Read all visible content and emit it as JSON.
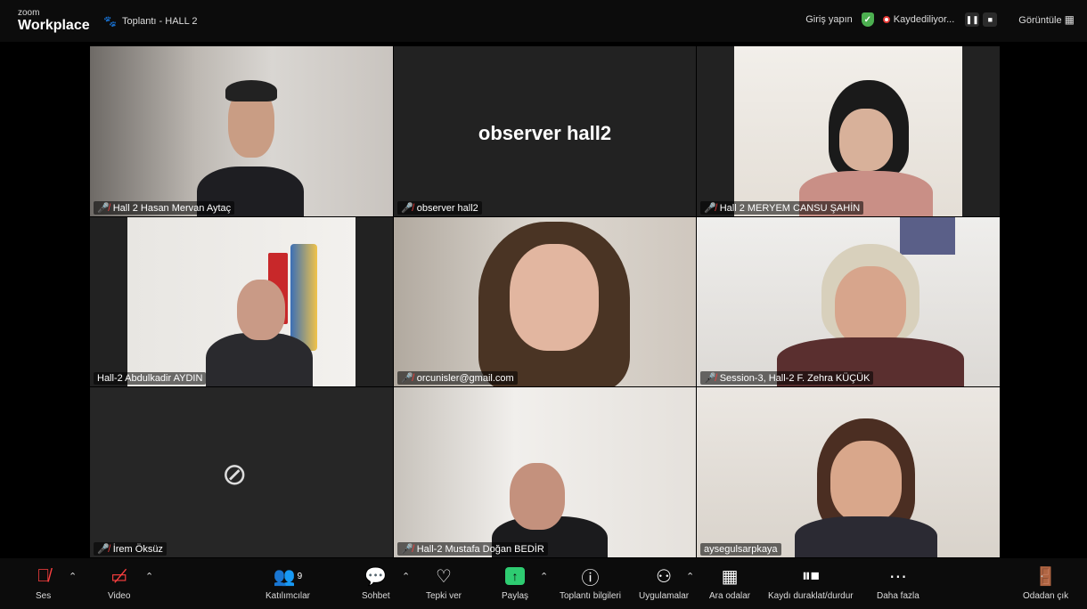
{
  "app": {
    "brand_small": "zoom",
    "brand_large": "Workplace"
  },
  "meeting": {
    "title": "Toplantı - HALL 2"
  },
  "topbar": {
    "signin": "Giriş yapın",
    "recording": "Kaydediliyor...",
    "view": "Görüntüle"
  },
  "tiles": [
    {
      "name": "Hall 2 Hasan Mervan Aytaç",
      "muted": true
    },
    {
      "name": "observer hall2",
      "muted": true,
      "center_text": "observer hall2"
    },
    {
      "name": "Hall 2 MERYEM CANSU ŞAHİN",
      "muted": true
    },
    {
      "name": "Hall-2 Abdulkadir AYDIN",
      "muted": false
    },
    {
      "name": "orcunisler@gmail.com",
      "muted": true
    },
    {
      "name": "Session-3, Hall-2 F. Zehra KÜÇÜK",
      "muted": true
    },
    {
      "name": "İrem Öksüz",
      "muted": true
    },
    {
      "name": "Hall-2  Mustafa Doğan BEDİR",
      "muted": true
    },
    {
      "name": "aysegulsarpkaya",
      "muted": false
    }
  ],
  "toolbar": {
    "audio": "Ses",
    "video": "Video",
    "participants": "Katılımcılar",
    "participants_count": "9",
    "chat": "Sohbet",
    "react": "Tepki ver",
    "share": "Paylaş",
    "info": "Toplantı bilgileri",
    "apps": "Uygulamalar",
    "breakout": "Ara odalar",
    "record": "Kaydı duraklat/durdur",
    "more": "Daha fazla",
    "leave": "Odadan çık"
  },
  "colors": {
    "accent_green": "#2ecc71",
    "mute_red": "#ff4040",
    "bg": "#000000"
  }
}
